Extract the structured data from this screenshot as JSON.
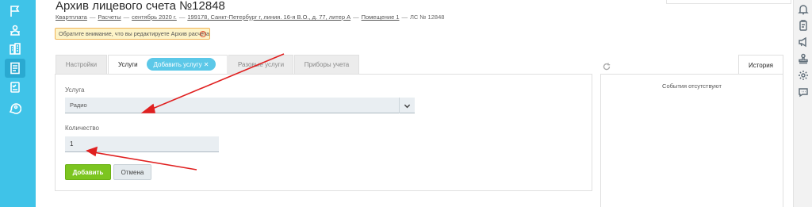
{
  "page": {
    "title": "Архив лицевого счета №12848"
  },
  "breadcrumb": {
    "items": [
      "Квартплата",
      "Расчеты",
      "сентябрь 2020 г.",
      "199178, Санкт-Петербург г, линия. 16-я В.О., д. 77, литер А",
      "Помещение 1",
      "ЛС № 12848"
    ],
    "separator": "—"
  },
  "notice": {
    "text": "Обратите внимание, что вы редактируете Архив расчета",
    "icon": "warning-circle-icon"
  },
  "tabs": [
    {
      "label": "Настройки"
    },
    {
      "label": "Услуги"
    },
    {
      "label": "Разовые услуги"
    },
    {
      "label": "Приборы учета"
    }
  ],
  "chip": {
    "label": "Добавить услугу ✕"
  },
  "form": {
    "service_label": "Услуга",
    "service_value": "Радио",
    "quantity_label": "Количество",
    "quantity_value": "1",
    "add_button": "Добавить",
    "cancel_button": "Отмена"
  },
  "history": {
    "tab_label": "История",
    "empty_text": "События отсутствуют"
  },
  "colors": {
    "sidebar": "#3fc3e8",
    "accent_chip": "#5cc8e8",
    "add_button": "#7cc520",
    "notice_bg": "#fdf3c7",
    "annotation_arrow": "#e02020"
  },
  "left_sidebar": {
    "icons": [
      "flag-icon",
      "group-icon",
      "building-icon",
      "document-icon",
      "checklist-icon",
      "chat-gear-icon"
    ]
  },
  "right_bar": {
    "icons": [
      "bell-icon",
      "clipboard-icon",
      "megaphone-icon",
      "stamp-icon",
      "settings-icon",
      "chat-icon"
    ]
  }
}
